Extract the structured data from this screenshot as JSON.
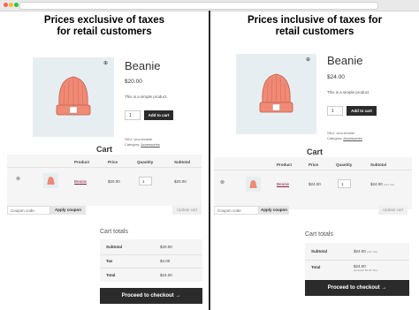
{
  "left": {
    "heading": "Prices exclusive of taxes\nfor retail customers",
    "product": {
      "title": "Beanie",
      "price": "$20.00",
      "description": "This is a simple product.",
      "qty": "1",
      "add_to_cart": "Add to cart",
      "sku_label": "SKU:",
      "sku": "woo-beanie",
      "category_label": "Category:",
      "category": "Accessories"
    },
    "cart": {
      "title": "Cart",
      "headers": [
        "Product",
        "Price",
        "Quantity",
        "Subtotal"
      ],
      "row": {
        "product": "Beanie",
        "price": "$20.00",
        "qty": "1",
        "subtotal": "$20.00"
      },
      "coupon_placeholder": "Coupon code",
      "apply_coupon": "Apply coupon",
      "update_cart": "Update cart"
    },
    "totals": {
      "title": "Cart totals",
      "rows": [
        {
          "label": "Subtotal",
          "value": "$20.00",
          "note": ""
        },
        {
          "label": "Tax",
          "value": "$4.00",
          "note": ""
        },
        {
          "label": "Total",
          "value": "$24.00",
          "note": ""
        }
      ],
      "checkout": "Proceed to checkout →"
    }
  },
  "right": {
    "heading": "Prices inclusive of taxes for\nretail customers",
    "product": {
      "title": "Beanie",
      "price": "$24.00",
      "description": "This is a simple product.",
      "qty": "1",
      "add_to_cart": "Add to cart",
      "sku_label": "SKU:",
      "sku": "woo-beanie",
      "category_label": "Category:",
      "category": "Accessories"
    },
    "cart": {
      "title": "Cart",
      "headers": [
        "Product",
        "Price",
        "Quantity",
        "Subtotal"
      ],
      "row": {
        "product": "Beanie",
        "price": "$24.00",
        "qty": "1",
        "subtotal": "$24.00",
        "subtotal_note": "(incl. tax)"
      },
      "coupon_placeholder": "Coupon code",
      "apply_coupon": "Apply coupon",
      "update_cart": "Update cart"
    },
    "totals": {
      "title": "Cart totals",
      "rows": [
        {
          "label": "Subtotal",
          "value": "$24.00",
          "note": "(incl. tax)"
        },
        {
          "label": "Total",
          "value": "$24.00",
          "note": "(includes $4.00 Tax)"
        }
      ],
      "checkout": "Proceed to checkout →"
    }
  },
  "colors": {
    "dot_red": "#ff5f57",
    "dot_yellow": "#febc2e",
    "dot_green": "#28c840",
    "button_dark": "#2b2b2b",
    "beanie": "#ef8a75",
    "product_bg": "#e7eef2"
  }
}
